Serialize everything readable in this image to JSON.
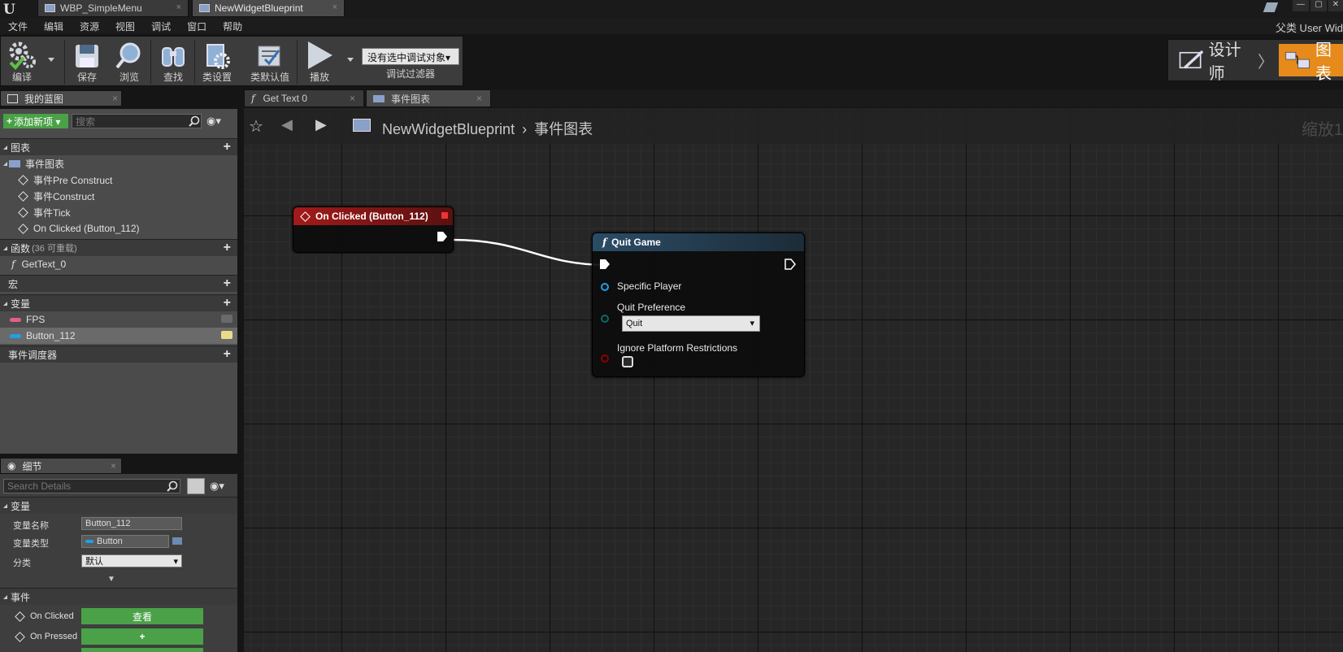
{
  "window": {
    "doc_tabs": [
      {
        "label": "WBP_SimpleMenu",
        "close": "×"
      },
      {
        "label": "NewWidgetBlueprint",
        "close": "×"
      }
    ],
    "parent_class": "父类 User Wid",
    "window_controls": [
      "—",
      "▢",
      "✕"
    ]
  },
  "menu": [
    "文件",
    "编辑",
    "资源",
    "视图",
    "调试",
    "窗口",
    "帮助"
  ],
  "toolbar": {
    "compile": "编译",
    "save": "保存",
    "browse": "浏览",
    "find": "查找",
    "class_settings": "类设置",
    "class_defaults": "类默认值",
    "play": "播放",
    "debug_object": "没有选中调试对象▾",
    "debug_filter": "调试过滤器"
  },
  "modes": {
    "designer": "设计师",
    "graph": "图表"
  },
  "my_blueprint": {
    "tab": "我的蓝图",
    "add_new": "添加新项 ▾",
    "search_placeholder": "搜索",
    "graphs": {
      "label": "图表",
      "event_graph": "事件图表",
      "events": [
        "事件Pre Construct",
        "事件Construct",
        "事件Tick",
        "On Clicked (Button_112)"
      ]
    },
    "functions": {
      "label": "函数",
      "count": "(36 可重载)",
      "items": [
        "GetText_0"
      ]
    },
    "macros": {
      "label": "宏"
    },
    "variables": {
      "label": "变量",
      "items": [
        "FPS",
        "Button_112"
      ]
    },
    "dispatchers": {
      "label": "事件调度器"
    }
  },
  "details": {
    "tab": "细节",
    "search_placeholder": "Search Details",
    "variable_section": "变量",
    "var_name_label": "变量名称",
    "var_name_value": "Button_112",
    "var_type_label": "变量类型",
    "var_type_value": "Button",
    "category_label": "分类",
    "category_value": "默认",
    "events_section": "事件",
    "on_clicked_label": "On Clicked",
    "on_clicked_button": "查看",
    "on_pressed_label": "On Pressed",
    "on_pressed_button": "+"
  },
  "graph": {
    "tabs": [
      {
        "label": "Get Text 0",
        "close": "×"
      },
      {
        "label": "事件图表",
        "close": "×"
      }
    ],
    "breadcrumb_bp": "NewWidgetBlueprint",
    "breadcrumb_sep": "›",
    "breadcrumb_graph": "事件图表",
    "zoom": "缩放1",
    "event_node": {
      "title": "On Clicked (Button_112)"
    },
    "quit_node": {
      "title": "Quit Game",
      "pin_player": "Specific Player",
      "pin_pref": "Quit Preference",
      "pref_value": "Quit",
      "pin_ignore": "Ignore Platform Restrictions",
      "ignore_checked": false
    }
  },
  "colors": {
    "accent_orange": "#e58a1b",
    "green": "#4aa147",
    "event_red": "#a31a1a",
    "function_blue": "#2b4c66"
  }
}
